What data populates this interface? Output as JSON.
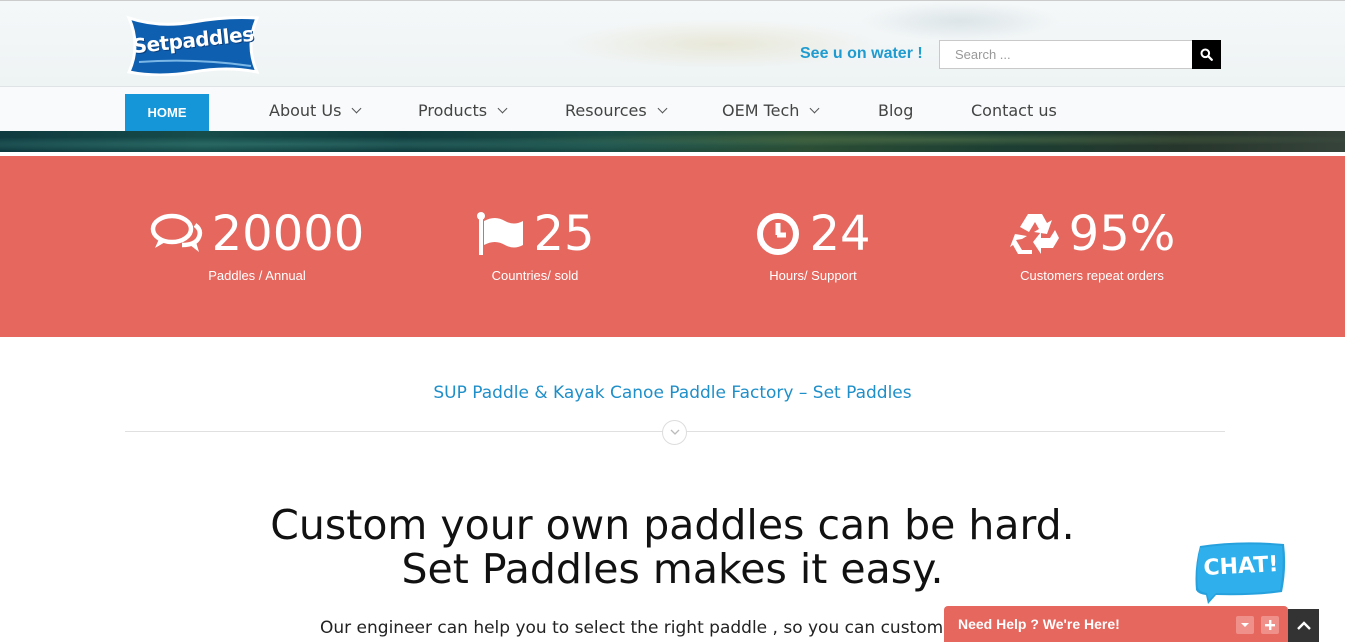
{
  "header": {
    "logo_text": "Setpaddles",
    "tagline": "See u on water !",
    "search": {
      "placeholder": "Search ..."
    }
  },
  "nav": {
    "items": [
      {
        "label": "HOME",
        "active": true
      },
      {
        "label": "About Us",
        "dropdown": true
      },
      {
        "label": "Products",
        "dropdown": true
      },
      {
        "label": "Resources",
        "dropdown": true
      },
      {
        "label": "OEM Tech",
        "dropdown": true
      },
      {
        "label": "Blog",
        "dropdown": false
      },
      {
        "label": "Contact us",
        "dropdown": false
      }
    ]
  },
  "stats": [
    {
      "icon": "comments-icon",
      "value": "20000",
      "label": "Paddles / Annual"
    },
    {
      "icon": "flag-icon",
      "value": "25",
      "label": "Countries/ sold"
    },
    {
      "icon": "clock-icon",
      "value": "24",
      "label": "Hours/ Support"
    },
    {
      "icon": "recycle-icon",
      "value": "95%",
      "label": "Customers repeat orders"
    }
  ],
  "main": {
    "subtitle": "SUP Paddle & Kayak Canoe Paddle Factory – Set Paddles",
    "headline_line1": "Custom your own paddles can be hard.",
    "headline_line2": "Set Paddles makes it easy.",
    "body": "Our engineer can help you to select the right paddle , so you can custom th"
  },
  "chat": {
    "bubble": "CHAT!",
    "bar_label": "Need Help ? We're Here!"
  },
  "colors": {
    "accent_blue": "#1496d8",
    "stats_band": "#e5675e",
    "link_blue": "#1f8fc9"
  }
}
